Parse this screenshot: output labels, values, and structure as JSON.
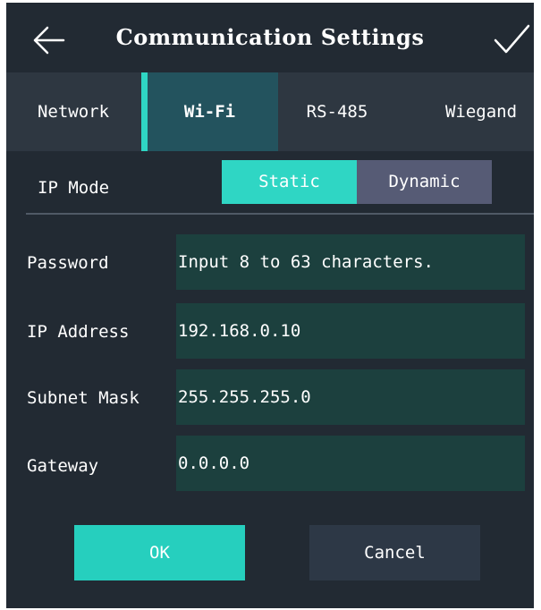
{
  "header": {
    "title": "Communication Settings",
    "back_icon": "arrow-left-icon",
    "confirm_icon": "checkmark-icon"
  },
  "tabs": [
    {
      "label": "Network",
      "active": false
    },
    {
      "label": "Wi-Fi",
      "active": true
    },
    {
      "label": "RS-485",
      "active": false
    },
    {
      "label": "Wiegand",
      "active": false
    }
  ],
  "ip_mode": {
    "label": "IP Mode",
    "options": [
      "Static",
      "Dynamic"
    ],
    "selected": "Static"
  },
  "fields": {
    "password": {
      "label": "Password",
      "value": "",
      "placeholder": "Input 8 to 63 characters."
    },
    "ip_address": {
      "label": "IP Address",
      "value": "192.168.0.10"
    },
    "subnet_mask": {
      "label": "Subnet Mask",
      "value": "255.255.255.0"
    },
    "gateway": {
      "label": "Gateway",
      "value": "0.0.0.0"
    }
  },
  "buttons": {
    "ok": "OK",
    "cancel": "Cancel"
  },
  "colors": {
    "background": "#222a33",
    "tab_bar": "#2e3741",
    "tab_active": "#23535e",
    "accent": "#2fd6c4",
    "segment_inactive": "#565b75",
    "field_bg": "#1c403e",
    "cancel_bg": "#2d3846"
  }
}
